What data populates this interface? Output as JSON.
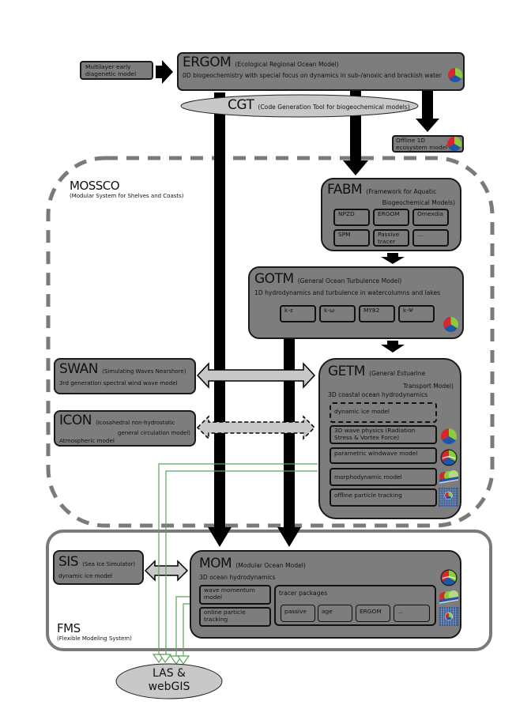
{
  "colors": {
    "box_fill": "#7d7d7d",
    "ellipse_fill": "#c8c8c8",
    "dashed_border": "#7a7a7a",
    "fms_border": "#7a7a7a",
    "data_line": "#5aa55a",
    "icon_red": "#d8262e",
    "icon_green": "#8ccc3a",
    "icon_blue": "#1f56a8"
  },
  "multilayer": {
    "label": "Multilayer early diagenetic model"
  },
  "ergom": {
    "title": "ERGOM",
    "subtitle": "(Ecological Regional Ocean Model)",
    "description": "0D biogeochemistry with special focus on dynamics in sub-/anoxic and brackish water"
  },
  "cgt": {
    "title": "CGT",
    "subtitle": "(Code Generation Tool for biogeochemical models)"
  },
  "offline1d": {
    "label": "Offline 1D ecosystem model"
  },
  "mossco": {
    "title": "MOSSCO",
    "subtitle": "(Modular System for Shelves and Coasts)"
  },
  "fabm": {
    "title": "FABM",
    "subtitle_line1": "(Framework for Aquatic",
    "subtitle_line2": "Biogeochemical Models)",
    "modules": [
      "NPZD",
      "ERGOM",
      "Omexdia",
      "SPM",
      "Passive tracer",
      "..."
    ]
  },
  "gotm": {
    "title": "GOTM",
    "subtitle": "(General Ocean Turbulence Model)",
    "description": "1D hydrodynamics and turbulence in watercolumns and lakes",
    "closures": [
      "k-ε",
      "k-ω",
      "MY82",
      "k-Ψ"
    ]
  },
  "swan": {
    "title": "SWAN",
    "subtitle": "(Simulating Waves Nearshore)",
    "description": "3rd generation spectral wind wave model"
  },
  "icon": {
    "title": "ICON",
    "subtitle_line1": "(Icosahedral non-hydrostatic",
    "subtitle_line2": "general circulation model)",
    "description": "Atmospheric model"
  },
  "getm": {
    "title": "GETM",
    "subtitle_line1": "(General Estuarine",
    "subtitle_line2": "Transport Model)",
    "description": "3D coastal ocean hydrodynamics",
    "modules": [
      "dynamic ice model",
      "3D wave physics (Radiation Stress & Vortex Force)",
      "parametric windwave model",
      "morphodynamic model",
      "offline particle tracking"
    ]
  },
  "fms": {
    "title": "FMS",
    "subtitle": "(Flexible Modeling System)"
  },
  "sis": {
    "title": "SIS",
    "subtitle": "(Sea Ice Simulator)",
    "description": "dynamic ice model"
  },
  "mom": {
    "title": "MOM",
    "subtitle": "(Modular Ocean Model)",
    "description": "3D ocean hydrodynamics",
    "modules": [
      "wave momentum model",
      "online particle tracking"
    ],
    "tracer_title": "tracer packages",
    "tracers": [
      "passive",
      "age",
      "ERGOM",
      "..."
    ]
  },
  "las": {
    "line1": "LAS &",
    "line2": "webGIS"
  },
  "icons": {
    "ergom": "mossco-logo-icon",
    "offline1d": "mossco-logo-icon",
    "gotm": "mossco-logo-icon",
    "getm_wave": "mossco-logo-icon",
    "getm_windwave": "wave-logo-icon",
    "getm_morpho": "morphodynamic-logo-icon",
    "getm_particle": "particle-grid-icon"
  }
}
